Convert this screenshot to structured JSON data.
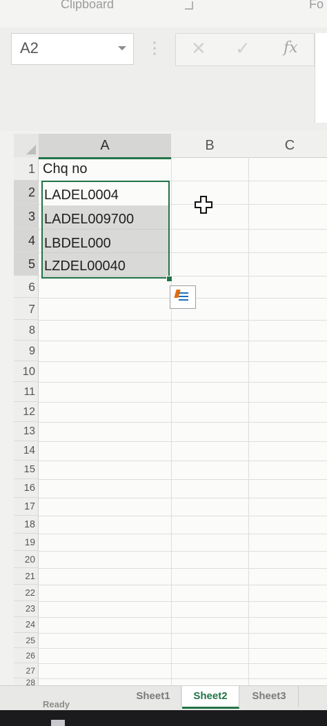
{
  "ribbon": {
    "clipboard_label": "Clipboard",
    "font_label": "Fo"
  },
  "formula_bar": {
    "name_box": "A2",
    "cancel_glyph": "✕",
    "enter_glyph": "✓",
    "fx_label": "fx",
    "formula_value": ""
  },
  "grid": {
    "columns": [
      "A",
      "B",
      "C"
    ],
    "selected_column": "A",
    "rows": [
      "1",
      "2",
      "3",
      "4",
      "5",
      "6",
      "7",
      "8",
      "9",
      "10",
      "11",
      "12",
      "13",
      "14",
      "15",
      "16",
      "17",
      "18",
      "19",
      "20",
      "21",
      "22",
      "23",
      "24",
      "25",
      "26",
      "27",
      "28"
    ],
    "selected_rows": [
      "2",
      "3",
      "4",
      "5"
    ],
    "cells": {
      "A1": "Chq no",
      "A2": "LADEL0004",
      "A3": "LADEL009700",
      "A4": "LBDEL000",
      "A5": "LZDEL00040"
    },
    "active_cell": "A2",
    "selection_range": "A2:A5"
  },
  "icons": {
    "quick_analysis": "quick-analysis-icon",
    "cursor": "cross-cursor-icon"
  },
  "sheets": {
    "tabs": [
      "Sheet1",
      "Sheet2",
      "Sheet3"
    ],
    "active": "Sheet2"
  },
  "status_bar": {
    "mode": "Ready"
  },
  "colors": {
    "accent": "#217346",
    "selection_fill": "#bebebc"
  }
}
